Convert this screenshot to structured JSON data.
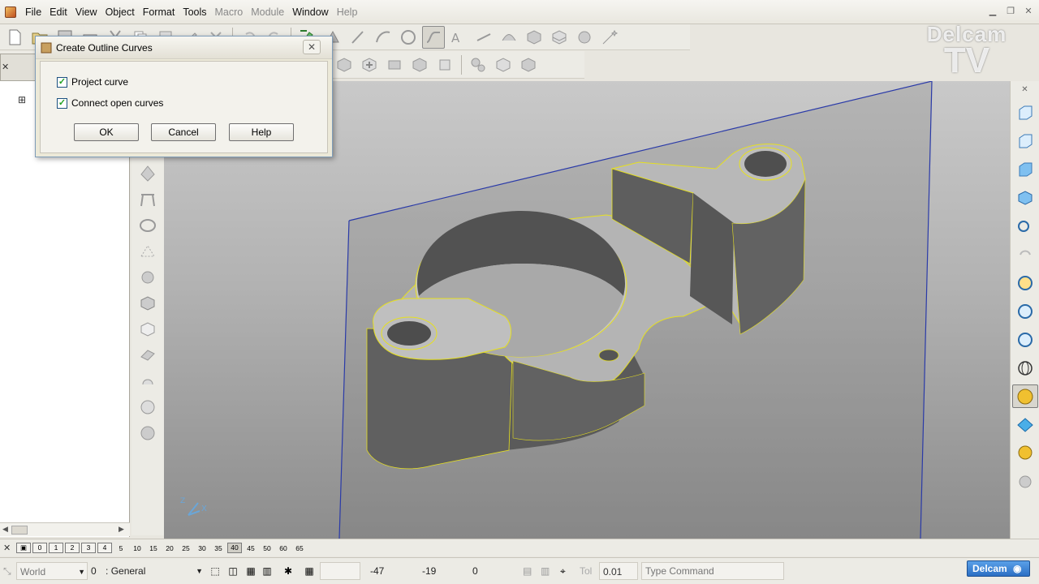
{
  "menu": {
    "items": [
      {
        "label": "File",
        "enabled": true
      },
      {
        "label": "Edit",
        "enabled": true
      },
      {
        "label": "View",
        "enabled": true
      },
      {
        "label": "Object",
        "enabled": true
      },
      {
        "label": "Format",
        "enabled": true
      },
      {
        "label": "Tools",
        "enabled": true
      },
      {
        "label": "Macro",
        "enabled": false
      },
      {
        "label": "Module",
        "enabled": false
      },
      {
        "label": "Window",
        "enabled": true
      },
      {
        "label": "Help",
        "enabled": false
      }
    ]
  },
  "watermark": {
    "line1": "Delcam",
    "line2": "TV"
  },
  "dialog": {
    "title": "Create Outline Curves",
    "close": "✕",
    "options": [
      {
        "label": "Project curve",
        "checked": true
      },
      {
        "label": "Connect open curves",
        "checked": true
      }
    ],
    "ok_label": "OK",
    "cancel_label": "Cancel",
    "help_label": "Help"
  },
  "layer_bar": {
    "close": "✕",
    "buttons": [
      "0",
      "1",
      "2",
      "3",
      "4"
    ],
    "numbers": [
      "5",
      "10",
      "15",
      "20",
      "25",
      "30",
      "35"
    ],
    "pressed": "40",
    "numbers2": [
      "45",
      "50",
      "60",
      "65"
    ]
  },
  "status": {
    "workplane": "World",
    "level": "0",
    "level_name": ": General",
    "x": "-47",
    "y": "-19",
    "z": "0",
    "tol_label": "Tol",
    "tol": "0.01",
    "command_placeholder": "Type Command",
    "brand": "Delcam"
  },
  "axis": {
    "z_label": "Z",
    "x_label": "X"
  },
  "colors": {
    "accent": "#2b6fc4",
    "edge": "#e6e020",
    "workplane": "#2a3aa8"
  }
}
